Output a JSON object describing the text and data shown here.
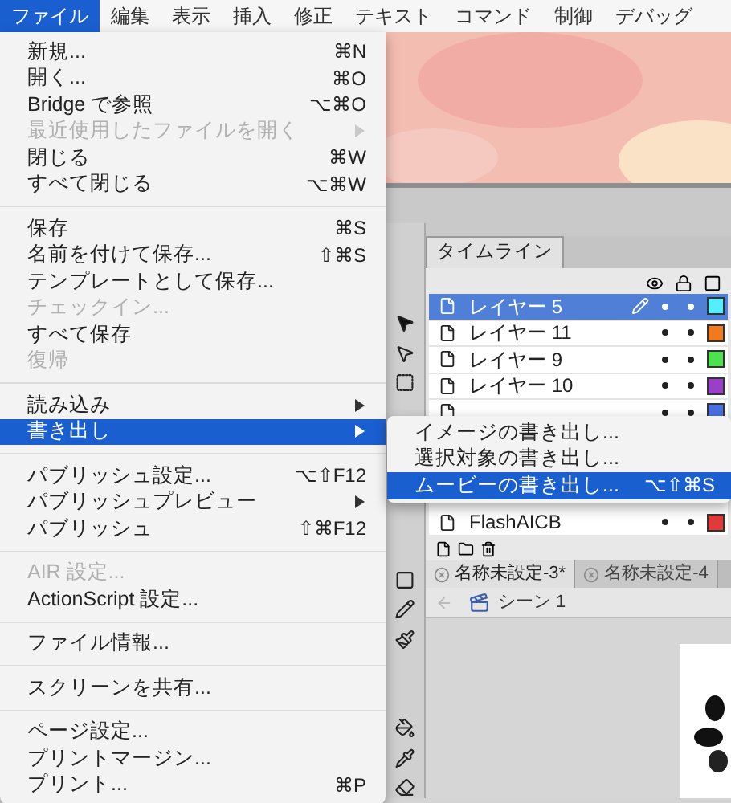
{
  "menubar": [
    {
      "label": "ファイル",
      "selected": true
    },
    {
      "label": "編集",
      "selected": false
    },
    {
      "label": "表示",
      "selected": false
    },
    {
      "label": "挿入",
      "selected": false
    },
    {
      "label": "修正",
      "selected": false
    },
    {
      "label": "テキスト",
      "selected": false
    },
    {
      "label": "コマンド",
      "selected": false
    },
    {
      "label": "制御",
      "selected": false
    },
    {
      "label": "デバッグ",
      "selected": false
    }
  ],
  "file_menu": {
    "sections": [
      [
        {
          "label": "新規...",
          "shortcut": "⌘N",
          "disabled": false,
          "submenu": false,
          "selected": false
        },
        {
          "label": "開く...",
          "shortcut": "⌘O",
          "disabled": false,
          "submenu": false,
          "selected": false
        },
        {
          "label": "Bridge で参照",
          "shortcut": "⌥⌘O",
          "disabled": false,
          "submenu": false,
          "selected": false
        },
        {
          "label": "最近使用したファイルを開く",
          "disabled": true,
          "submenu": true,
          "selected": false
        },
        {
          "label": "閉じる",
          "shortcut": "⌘W",
          "disabled": false,
          "submenu": false,
          "selected": false
        },
        {
          "label": "すべて閉じる",
          "shortcut": "⌥⌘W",
          "disabled": false,
          "submenu": false,
          "selected": false
        }
      ],
      [
        {
          "label": "保存",
          "shortcut": "⌘S",
          "disabled": false,
          "submenu": false,
          "selected": false
        },
        {
          "label": "名前を付けて保存...",
          "shortcut": "⇧⌘S",
          "disabled": false,
          "submenu": false,
          "selected": false
        },
        {
          "label": "テンプレートとして保存...",
          "disabled": false,
          "submenu": false,
          "selected": false
        },
        {
          "label": "チェックイン...",
          "disabled": true,
          "submenu": false,
          "selected": false
        },
        {
          "label": "すべて保存",
          "disabled": false,
          "submenu": false,
          "selected": false
        },
        {
          "label": "復帰",
          "disabled": true,
          "submenu": false,
          "selected": false
        }
      ],
      [
        {
          "label": "読み込み",
          "disabled": false,
          "submenu": true,
          "selected": false
        },
        {
          "label": "書き出し",
          "disabled": false,
          "submenu": true,
          "selected": true
        }
      ],
      [
        {
          "label": "パブリッシュ設定...",
          "shortcut": "⌥⇧F12",
          "disabled": false,
          "submenu": false,
          "selected": false
        },
        {
          "label": "パブリッシュプレビュー",
          "disabled": false,
          "submenu": true,
          "selected": false
        },
        {
          "label": "パブリッシュ",
          "shortcut": "⇧⌘F12",
          "disabled": false,
          "submenu": false,
          "selected": false
        }
      ],
      [
        {
          "label": "AIR 設定...",
          "disabled": true,
          "submenu": false,
          "selected": false
        },
        {
          "label": "ActionScript 設定...",
          "disabled": false,
          "submenu": false,
          "selected": false
        }
      ],
      [
        {
          "label": "ファイル情報...",
          "disabled": false,
          "submenu": false,
          "selected": false
        }
      ],
      [
        {
          "label": "スクリーンを共有...",
          "disabled": false,
          "submenu": false,
          "selected": false
        }
      ],
      [
        {
          "label": "ページ設定...",
          "disabled": false,
          "submenu": false,
          "selected": false
        },
        {
          "label": "プリントマージン...",
          "disabled": false,
          "submenu": false,
          "selected": false
        },
        {
          "label": "プリント...",
          "shortcut": "⌘P",
          "disabled": false,
          "submenu": false,
          "selected": false
        }
      ]
    ]
  },
  "export_submenu": [
    {
      "label": "イメージの書き出し...",
      "selected": false
    },
    {
      "label": "選択対象の書き出し...",
      "selected": false
    },
    {
      "label": "ムービーの書き出し...",
      "shortcut": "⌥⇧⌘S",
      "selected": true
    }
  ],
  "timeline": {
    "title": "タイムライン",
    "layers": [
      {
        "name": "レイヤー 5",
        "selected": true,
        "editing": true,
        "color": "#55eeff"
      },
      {
        "name": "レイヤー 11",
        "selected": false,
        "editing": false,
        "color": "#f07a20"
      },
      {
        "name": "レイヤー 9",
        "selected": false,
        "editing": false,
        "color": "#4fe04f"
      },
      {
        "name": "レイヤー 10",
        "selected": false,
        "editing": false,
        "color": "#9a3fc8"
      },
      {
        "selected": false,
        "editing": false,
        "color": "#4a6fe0"
      }
    ],
    "bottom_layer": {
      "name": "FlashAICB",
      "selected": false,
      "editing": false,
      "color": "#e03a3a"
    }
  },
  "doc_tabs": [
    {
      "label": "名称未設定-3*",
      "selected": true
    },
    {
      "label": "名称未設定-4",
      "selected": false
    }
  ],
  "scene": "シーン 1"
}
